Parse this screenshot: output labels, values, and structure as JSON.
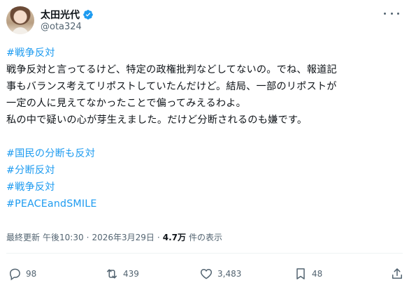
{
  "author": {
    "display_name": "太田光代",
    "handle": "@ota324"
  },
  "tweet": {
    "lines": [
      {
        "text": "#戦争反対",
        "hashtag": true
      },
      {
        "text": "戦争反対と言ってるけど、特定の政権批判などしてないの。でね、報道記",
        "hashtag": false
      },
      {
        "text": "事もバランス考えてリポストしていたんだけど。結局、一部のリポストが",
        "hashtag": false
      },
      {
        "text": "一定の人に見えてなかったことで偏ってみえるわよ。",
        "hashtag": false
      },
      {
        "text": "私の中で疑いの心が芽生えました。だけど分断されるのも嫌です。",
        "hashtag": false
      },
      {
        "text": "",
        "hashtag": false
      },
      {
        "text": "#国民の分断も反対",
        "hashtag": true
      },
      {
        "text": "#分断反対",
        "hashtag": true
      },
      {
        "text": "#戦争反対",
        "hashtag": true
      },
      {
        "text": "#PEACEandSMILE",
        "hashtag": true
      }
    ]
  },
  "meta": {
    "edited_label": "最終更新",
    "time": "午後10:30",
    "separator": "·",
    "date": "2026年3月29日",
    "separator2": "·",
    "views_count": "4.7万",
    "views_label": "件の表示"
  },
  "actions": {
    "replies": "98",
    "reposts": "439",
    "likes": "3,483",
    "bookmarks": "48"
  },
  "colors": {
    "hashtag": "#1d9bf0",
    "verified": "#1d9bf0",
    "secondary_text": "#536471"
  },
  "icons": [
    "verified-badge-icon",
    "more-icon",
    "reply-icon",
    "repost-icon",
    "like-icon",
    "bookmark-icon",
    "share-icon"
  ]
}
